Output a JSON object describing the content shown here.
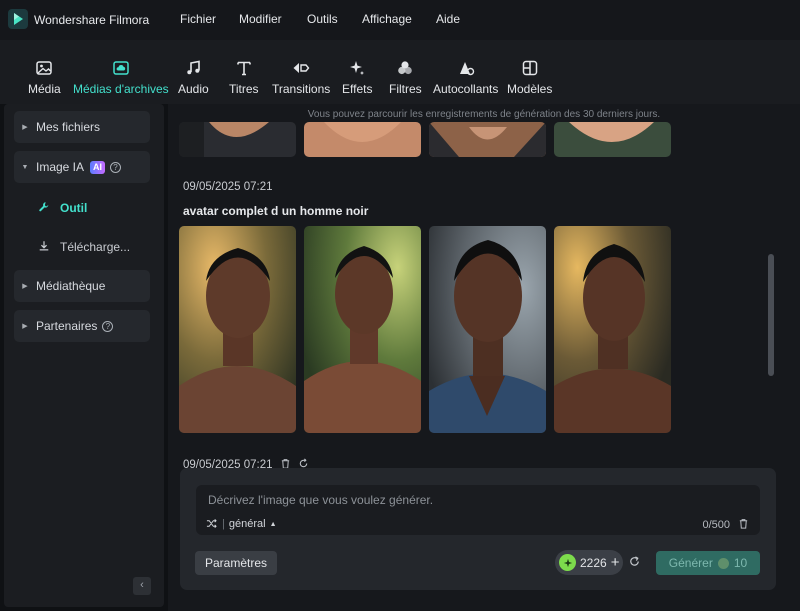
{
  "app": {
    "name": "Wondershare Filmora"
  },
  "menu": [
    "Fichier",
    "Modifier",
    "Outils",
    "Affichage",
    "Aide"
  ],
  "toolbar": [
    {
      "label": "Média",
      "icon": "image-icon"
    },
    {
      "label": "Médias d'archives",
      "icon": "cloud-folder-icon",
      "active": true
    },
    {
      "label": "Audio",
      "icon": "music-note-icon"
    },
    {
      "label": "Titres",
      "icon": "text-icon"
    },
    {
      "label": "Transitions",
      "icon": "transition-arrows-icon"
    },
    {
      "label": "Effets",
      "icon": "sparkle-icon"
    },
    {
      "label": "Filtres",
      "icon": "filter-circles-icon"
    },
    {
      "label": "Autocollants",
      "icon": "sticker-icon"
    },
    {
      "label": "Modèles",
      "icon": "template-grid-icon"
    }
  ],
  "sidebar": {
    "mes_fichiers": "Mes fichiers",
    "image_ia": "Image IA",
    "ai_badge": "AI",
    "outil": "Outil",
    "telecharge": "Télécharge...",
    "mediatheque": "Médiathèque",
    "partenaires": "Partenaires"
  },
  "main": {
    "hint": "Vous pouvez parcourir les enregistrements de génération des 30 derniers jours.",
    "group1": {
      "date": "09/05/2025 07:21",
      "prompt": "avatar complet d un homme noir"
    },
    "group2": {
      "date": "09/05/2025 07:21"
    }
  },
  "composer": {
    "placeholder": "Décrivez l'image que vous voulez générer.",
    "style": "général",
    "counter": "0/500",
    "params_label": "Paramètres",
    "credits": "2226",
    "generate_label": "Générer",
    "generate_cost": "10"
  },
  "colors": {
    "accent": "#43e0cc",
    "generate": "#2f6b62",
    "credit_coin": "#7ddc4c"
  }
}
